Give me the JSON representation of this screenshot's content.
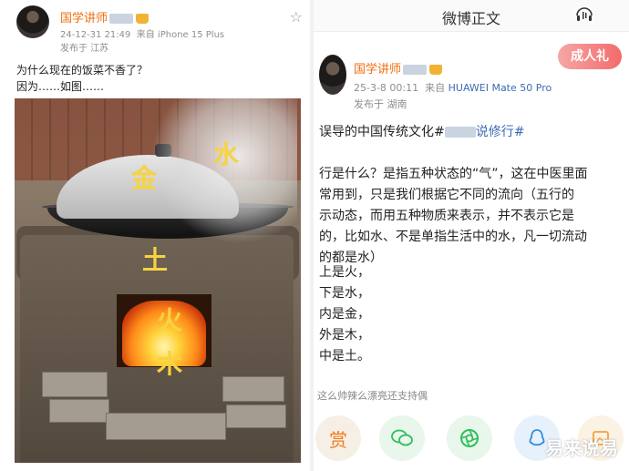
{
  "left_post": {
    "author_name": "国学讲师",
    "time": "24-12-31 21:49",
    "source": "来自 iPhone 15 Plus",
    "location": "发布于 江苏",
    "line1": "为什么现在的饭菜不香了？",
    "line2": "因为……如图……",
    "photo_labels": {
      "water": "水",
      "metal": "金",
      "earth": "土",
      "fire": "火",
      "wood": "木"
    }
  },
  "right_post": {
    "header_title": "微博正文",
    "author_name": "国学讲师",
    "time": "25-3-8 00:11",
    "source_prefix": "来自",
    "source_device": "HUAWEI Mate 50 Pro",
    "location": "发布于 湖南",
    "badge": "成人礼",
    "intro": "误导的中国传统文化#",
    "intro_tag_end": "说修行#",
    "para_lines": [
      "行是什么？是指五种状态的“气”，这在中医里面",
      "常用到，只是我们根据它不同的流向（五行的",
      "示动态，而用五种物质来表示，并不表示它是",
      "的，比如水、不是单指生活中的水，凡一切流动",
      "的都是水）"
    ],
    "list_lines": [
      "上是火，",
      "下是水，",
      "内是金，",
      "外是木，",
      "中是土。"
    ],
    "comment_hint": "这么帅辣么漂亮还支持偶",
    "actions": [
      "赏",
      "微信",
      "朋友圈",
      "QQ",
      "更多"
    ],
    "watermark": "易来说易"
  }
}
